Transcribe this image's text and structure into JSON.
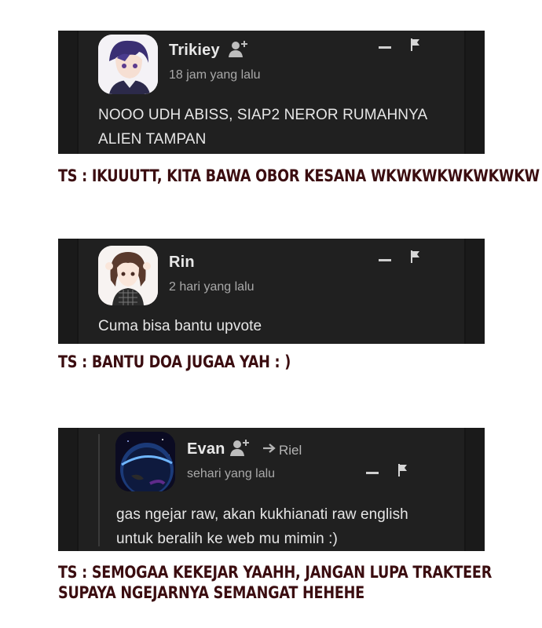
{
  "comments": [
    {
      "user": "Trikiey",
      "time": "18 jam yang lalu",
      "text_lines": [
        "NOOO UDH ABISS, SIAP2 NEROR RUMAHNYA",
        "ALIEN TAMPAN"
      ],
      "ts_reply_lines": [
        "TS : IKUUUTT, KITA BAWA OBOR KESANA WKWKWKWKWKWKW"
      ]
    },
    {
      "user": "Rin",
      "time": "2 hari yang lalu",
      "text_lines": [
        "Cuma bisa bantu upvote"
      ],
      "ts_reply_lines": [
        "TS : BANTU DOA JUGAA YAH : )"
      ]
    },
    {
      "user": "Evan",
      "reply_to": "Riel",
      "time": "sehari yang lalu",
      "text_lines": [
        "gas ngejar raw, akan kukhianati raw english",
        "untuk beralih ke web mu mimin :)"
      ],
      "ts_reply_lines": [
        "TS : SEMOGAA KEKEJAR YAAHH, JANGAN LUPA TRAKTEER",
        "SUPAYA NGEJARNYA SEMANGAT HEHEHE"
      ]
    }
  ],
  "icons": [
    "add-friend-icon",
    "minimize-icon",
    "flag-icon",
    "reply-arrow-icon"
  ],
  "colors": {
    "card_bg": "#202020",
    "ts_text": "#3b0d10",
    "name": "#e8e8e8",
    "meta": "#a9a9a9"
  }
}
